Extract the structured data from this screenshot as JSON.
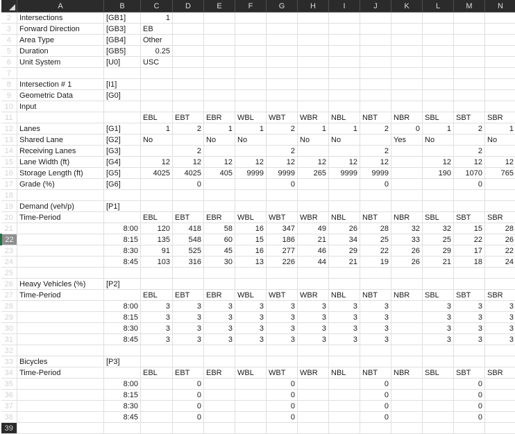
{
  "app": {
    "type": "spreadsheet",
    "select_all_icon": "select-all-triangle"
  },
  "columns": [
    "A",
    "B",
    "C",
    "D",
    "E",
    "F",
    "G",
    "H",
    "I",
    "J",
    "K",
    "L",
    "M",
    "N"
  ],
  "row_numbers": [
    "2",
    "3",
    "4",
    "5",
    "6",
    "7",
    "8",
    "9",
    "10",
    "11",
    "12",
    "13",
    "14",
    "15",
    "16",
    "17",
    "18",
    "19",
    "20",
    "21",
    "22",
    "23",
    "24",
    "25",
    "26",
    "27",
    "28",
    "29",
    "30",
    "31",
    "32",
    "33",
    "34",
    "35",
    "36",
    "37",
    "38",
    "39"
  ],
  "active_row": "22",
  "accent_color": "#217346",
  "header_bg": "#2b2b2b",
  "directions": [
    "EBL",
    "EBT",
    "EBR",
    "WBL",
    "WBT",
    "WBR",
    "NBL",
    "NBT",
    "NBR",
    "SBL",
    "SBT",
    "SBR"
  ],
  "global": {
    "rows": [
      {
        "row": "2",
        "label": "Intersections",
        "code": "[GB1]",
        "value": "1",
        "align": "num"
      },
      {
        "row": "3",
        "label": "Forward Direction",
        "code": "[GB3]",
        "value": "EB",
        "align": "txt"
      },
      {
        "row": "4",
        "label": "Area Type",
        "code": "[GB4]",
        "value": "Other",
        "align": "txt"
      },
      {
        "row": "5",
        "label": "Duration",
        "code": "[GB5]",
        "value": "0.25",
        "align": "num"
      },
      {
        "row": "6",
        "label": "Unit System",
        "code": "[U0]",
        "value": "USC",
        "align": "txt"
      }
    ]
  },
  "intersection": {
    "row8_label": "Intersection # 1",
    "row8_code": "[I1]",
    "row9_label": "Geometric Data",
    "row9_code": "[G0]",
    "row10_label": "Input"
  },
  "geometric": {
    "header_row": "11",
    "rows": [
      {
        "row": "12",
        "label": "Lanes",
        "code": "[G1]",
        "values": [
          "1",
          "2",
          "1",
          "1",
          "2",
          "1",
          "1",
          "2",
          "0",
          "1",
          "2",
          "1"
        ],
        "align": "num"
      },
      {
        "row": "13",
        "label": "Shared Lane",
        "code": "[G2]",
        "values": [
          "No",
          "",
          "No",
          "No",
          "",
          "No",
          "No",
          "",
          "Yes",
          "No",
          "",
          "No"
        ],
        "align": "txt"
      },
      {
        "row": "14",
        "label": "Receiving Lanes",
        "code": "[G3]",
        "values": [
          "",
          "2",
          "",
          "",
          "2",
          "",
          "",
          "2",
          "",
          "",
          "2",
          ""
        ],
        "align": "num"
      },
      {
        "row": "15",
        "label": "Lane Width (ft)",
        "code": "[G4]",
        "values": [
          "12",
          "12",
          "12",
          "12",
          "12",
          "12",
          "12",
          "12",
          "",
          "12",
          "12",
          "12"
        ],
        "align": "num"
      },
      {
        "row": "16",
        "label": "Storage Length (ft)",
        "code": "[G5]",
        "values": [
          "4025",
          "4025",
          "405",
          "9999",
          "9999",
          "265",
          "9999",
          "9999",
          "",
          "190",
          "1070",
          "765"
        ],
        "align": "num"
      },
      {
        "row": "17",
        "label": "Grade (%)",
        "code": "[G6]",
        "values": [
          "",
          "0",
          "",
          "",
          "0",
          "",
          "",
          "0",
          "",
          "",
          "0",
          ""
        ],
        "align": "num"
      }
    ]
  },
  "demand": {
    "title_row": "19",
    "title": "Demand (veh/p)",
    "code": "[P1]",
    "header_row": "20",
    "header_label": "Time-Period",
    "rows": [
      {
        "row": "21",
        "time": "8:00",
        "values": [
          "120",
          "418",
          "58",
          "16",
          "347",
          "49",
          "26",
          "28",
          "32",
          "32",
          "15",
          "28"
        ]
      },
      {
        "row": "22",
        "time": "8:15",
        "values": [
          "135",
          "548",
          "60",
          "15",
          "186",
          "21",
          "34",
          "25",
          "33",
          "25",
          "22",
          "26"
        ]
      },
      {
        "row": "23",
        "time": "8:30",
        "values": [
          "91",
          "525",
          "45",
          "16",
          "277",
          "46",
          "29",
          "22",
          "26",
          "29",
          "17",
          "22"
        ]
      },
      {
        "row": "24",
        "time": "8:45",
        "values": [
          "103",
          "316",
          "30",
          "13",
          "226",
          "44",
          "21",
          "19",
          "26",
          "21",
          "18",
          "24"
        ]
      }
    ]
  },
  "heavy_vehicles": {
    "title_row": "26",
    "title": "Heavy Vehicles (%)",
    "code": "[P2]",
    "header_row": "27",
    "header_label": "Time-Period",
    "rows": [
      {
        "row": "28",
        "time": "8:00",
        "values": [
          "3",
          "3",
          "3",
          "3",
          "3",
          "3",
          "3",
          "3",
          "",
          "3",
          "3",
          "3"
        ]
      },
      {
        "row": "29",
        "time": "8:15",
        "values": [
          "3",
          "3",
          "3",
          "3",
          "3",
          "3",
          "3",
          "3",
          "",
          "3",
          "3",
          "3"
        ]
      },
      {
        "row": "30",
        "time": "8:30",
        "values": [
          "3",
          "3",
          "3",
          "3",
          "3",
          "3",
          "3",
          "3",
          "",
          "3",
          "3",
          "3"
        ]
      },
      {
        "row": "31",
        "time": "8:45",
        "values": [
          "3",
          "3",
          "3",
          "3",
          "3",
          "3",
          "3",
          "3",
          "",
          "3",
          "3",
          "3"
        ]
      }
    ]
  },
  "bicycles": {
    "title_row": "33",
    "title": "Bicycles",
    "code": "[P3]",
    "header_row": "34",
    "header_label": "Time-Period",
    "rows": [
      {
        "row": "35",
        "time": "8:00",
        "values": [
          "",
          "0",
          "",
          "",
          "0",
          "",
          "",
          "0",
          "",
          "",
          "0",
          ""
        ]
      },
      {
        "row": "36",
        "time": "8:15",
        "values": [
          "",
          "0",
          "",
          "",
          "0",
          "",
          "",
          "0",
          "",
          "",
          "0",
          ""
        ]
      },
      {
        "row": "37",
        "time": "8:30",
        "values": [
          "",
          "0",
          "",
          "",
          "0",
          "",
          "",
          "0",
          "",
          "",
          "0",
          ""
        ]
      },
      {
        "row": "38",
        "time": "8:45",
        "values": [
          "",
          "0",
          "",
          "",
          "0",
          "",
          "",
          "0",
          "",
          "",
          "0",
          ""
        ]
      }
    ]
  }
}
